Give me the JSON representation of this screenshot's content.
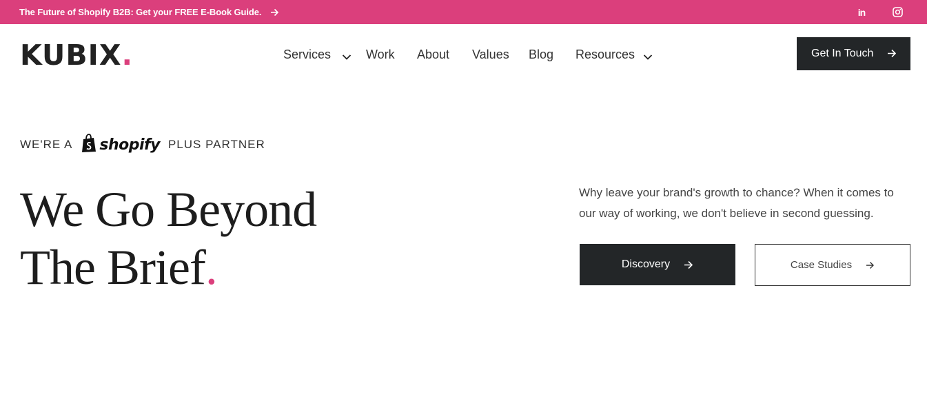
{
  "announcement": {
    "text": "The Future of Shopify B2B: Get your FREE E-Book Guide."
  },
  "social": {
    "linkedin_label": "in"
  },
  "brand": {
    "name": "KUBIX",
    "dot": ".",
    "accent_color": "#db3f7c",
    "dark_color": "#232628"
  },
  "nav": {
    "items": [
      {
        "label": "Services",
        "has_dropdown": true
      },
      {
        "label": "Work"
      },
      {
        "label": "About"
      },
      {
        "label": "Values"
      },
      {
        "label": "Blog"
      },
      {
        "label": "Resources",
        "has_dropdown": true
      }
    ],
    "cta_label": "Get In Touch"
  },
  "hero": {
    "partner_prefix": "WE'RE A",
    "partner_brand": "shopify",
    "partner_suffix": "PLUS PARTNER",
    "title_line1": "We Go Beyond",
    "title_line2": "The Brief",
    "title_dot": ".",
    "intro": "Why leave your brand's growth to chance? When it comes to our way of working, we don't believe in second guessing.",
    "primary_button": "Discovery",
    "secondary_button": "Case Studies"
  }
}
